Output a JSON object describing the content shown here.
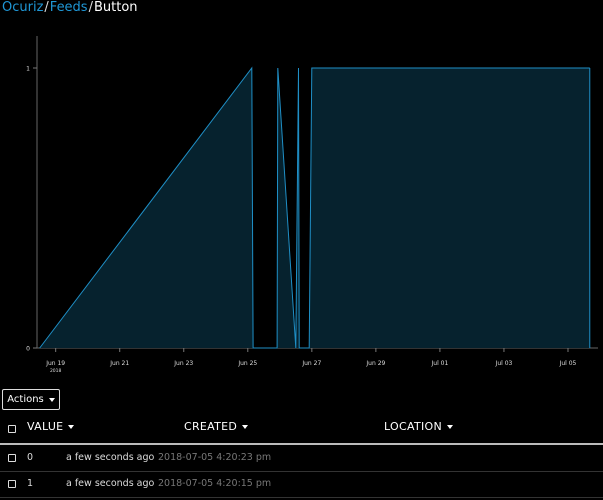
{
  "breadcrumb": {
    "items": [
      "Ocuriz",
      "Feeds"
    ],
    "separator": "/",
    "current": "Button"
  },
  "chart_data": {
    "type": "area",
    "x_type": "date",
    "x": [
      "2018-06-18T12:00",
      "2018-06-25T03:00",
      "2018-06-25T04:00",
      "2018-06-25T22:00",
      "2018-06-25T22:30",
      "2018-06-26T12:00",
      "2018-06-26T14:00",
      "2018-06-26T14:30",
      "2018-06-26T22:00",
      "2018-06-27T00:00",
      "2018-07-05T16:20"
    ],
    "series": [
      {
        "values": [
          0,
          1,
          0,
          0,
          1,
          0,
          1,
          0,
          0,
          1,
          1
        ]
      }
    ],
    "ylim": [
      0,
      1
    ],
    "yticks": [
      "0",
      "1"
    ],
    "xticks": [
      {
        "label": "Jun 19",
        "date": "2018-06-19",
        "sub": "2018"
      },
      {
        "label": "Jun 21",
        "date": "2018-06-21"
      },
      {
        "label": "Jun 23",
        "date": "2018-06-23"
      },
      {
        "label": "Jun 25",
        "date": "2018-06-25"
      },
      {
        "label": "Jun 27",
        "date": "2018-06-27"
      },
      {
        "label": "Jun 29",
        "date": "2018-06-29"
      },
      {
        "label": "Jul 01",
        "date": "2018-07-01"
      },
      {
        "label": "Jul 03",
        "date": "2018-07-03"
      },
      {
        "label": "Jul 05",
        "date": "2018-07-05"
      }
    ],
    "xlim": [
      "2018-06-18T10:00",
      "2018-07-05T18:00"
    ],
    "line_color": "#1f8fc6",
    "fill_color": "#06222e",
    "grid": false
  },
  "actions": {
    "label": "Actions"
  },
  "table": {
    "headers": {
      "value": "VALUE",
      "created": "CREATED",
      "location": "LOCATION"
    },
    "rows": [
      {
        "value": "0",
        "relative": "a few seconds ago",
        "timestamp": "2018-07-05 4:20:23 pm"
      },
      {
        "value": "1",
        "relative": "a few seconds ago",
        "timestamp": "2018-07-05 4:20:15 pm"
      }
    ]
  },
  "colors": {
    "link": "#1f97d6",
    "background": "#000000"
  }
}
